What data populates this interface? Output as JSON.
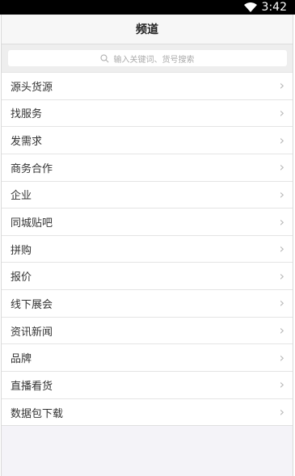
{
  "status_bar": {
    "time": "3:42",
    "wifi_icon": "wifi-icon"
  },
  "header": {
    "title": "频道"
  },
  "search": {
    "placeholder": "输入关键词、货号搜索",
    "icon": "search-icon"
  },
  "channels": [
    {
      "label": "源头货源"
    },
    {
      "label": "找服务"
    },
    {
      "label": "发需求"
    },
    {
      "label": "商务合作"
    },
    {
      "label": "企业"
    },
    {
      "label": "同城贴吧"
    },
    {
      "label": "拼购"
    },
    {
      "label": "报价"
    },
    {
      "label": "线下展会"
    },
    {
      "label": "资讯新闻"
    },
    {
      "label": "品牌"
    },
    {
      "label": "直播看货"
    },
    {
      "label": "数据包下载"
    }
  ],
  "chevron_icon": "chevron-right-icon"
}
